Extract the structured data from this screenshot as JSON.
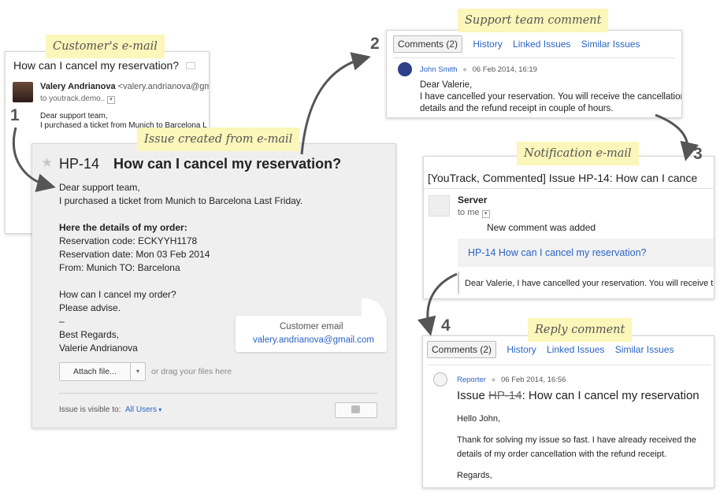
{
  "labels": {
    "customer_email": "Customer's e-mail",
    "issue_created": "Issue created from e-mail",
    "support_comment": "Support team comment",
    "notification_email": "Notification e-mail",
    "reply_comment": "Reply comment"
  },
  "steps": [
    "1",
    "2",
    "3",
    "4"
  ],
  "customer_mail": {
    "subject": "How can I cancel my reservation?",
    "sender_name": "Valery Andrianova",
    "sender_email": "<valery.andrianova@gmail",
    "to": "to youtrack.demo..",
    "body": [
      "Dear support team,",
      "I purchased a ticket from Munich to Barcelona L"
    ]
  },
  "issue": {
    "id": "HP-14",
    "title": "How can I cancel my reservation?",
    "body": [
      "Dear support team,",
      "I purchased a ticket from Munich to Barcelona Last Friday.",
      "",
      "Here the details of my order:",
      "Reservation code: ECKYYH1178",
      "Reservation date: Mon 03 Feb 2014",
      "From: Munich TO: Barcelona",
      "",
      "How can I cancel my order?",
      "Please advise.",
      "–",
      "Best Regards,",
      "Valerie Andrianova"
    ],
    "tooltip_title": "Customer email",
    "tooltip_email": "valery.andrianova@gmail.com",
    "attach_label": "Attach file...",
    "drag_hint": "or drag your files here",
    "visibility_label": "Issue is visible to:",
    "visibility_value": "All Users"
  },
  "support": {
    "tabs": [
      "Comments (2)",
      "History",
      "Linked Issues",
      "Similar Issues"
    ],
    "author": "John Smith",
    "date": "06 Feb 2014, 16:19",
    "body": [
      "Dear Valerie,",
      "I have cancelled your reservation. You will receive the cancellation",
      "details and the refund receipt in couple of hours."
    ]
  },
  "notification": {
    "subject": "[YouTrack, Commented] Issue HP-14: How can I cance",
    "sender": "Server",
    "to": "to me",
    "info": "New comment was added",
    "issue_link": "HP-14 How can I cancel my reservation?",
    "quote": "Dear Valerie, I have cancelled your reservation. You will receive th"
  },
  "reply": {
    "tabs": [
      "Comments (2)",
      "History",
      "Linked Issues",
      "Similar Issues"
    ],
    "author": "Reporter",
    "date": "06 Feb 2014, 16:56",
    "issue_prefix": "Issue",
    "issue_id": "HP-14",
    "issue_title": ": How can I cancel my reservation",
    "body": [
      "Hello John,",
      "",
      "Thank for solving my issue so fast. I have already received the",
      "details of my order cancellation with the refund receipt.",
      "",
      "Regards,"
    ]
  }
}
